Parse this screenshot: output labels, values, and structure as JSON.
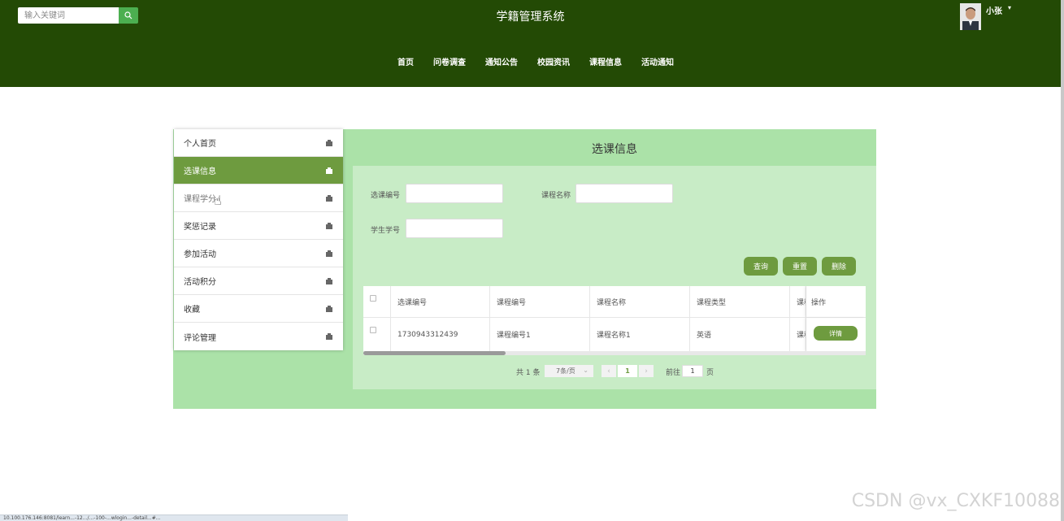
{
  "header": {
    "search": {
      "placeholder": "输入关键词"
    },
    "site_title": "学籍管理系统",
    "user": {
      "name": "小张",
      "caret": "▾"
    },
    "nav": [
      "首页",
      "问卷调查",
      "通知公告",
      "校园资讯",
      "课程信息",
      "活动通知"
    ]
  },
  "sidebar": {
    "items": [
      {
        "label": "个人首页"
      },
      {
        "label": "选课信息"
      },
      {
        "label": "课程学分"
      },
      {
        "label": "奖惩记录"
      },
      {
        "label": "参加活动"
      },
      {
        "label": "活动积分"
      },
      {
        "label": "收藏"
      },
      {
        "label": "评论管理"
      }
    ],
    "active_index": 1
  },
  "main": {
    "title": "选课信息",
    "filters": {
      "course_select_no_label": "选课编号",
      "course_name_label": "课程名称",
      "student_no_label": "学生学号"
    },
    "buttons": {
      "query": "查询",
      "reset": "重置",
      "delete": "删除"
    },
    "table": {
      "headers": [
        "选课编号",
        "课程编号",
        "课程名称",
        "课程类型",
        "课程",
        "操作"
      ],
      "rows": [
        {
          "select_no": "1730943312439",
          "course_no": "课程编号1",
          "course_name": "课程名称1",
          "course_type": "英语",
          "course_extra": "课程",
          "action": "详情"
        }
      ]
    },
    "pagination": {
      "total": "共 1 条",
      "page_size": "7条/页",
      "prev": "‹",
      "current_page": "1",
      "next": "›",
      "goto_label": "前往",
      "goto_value": "1",
      "page_unit": "页"
    }
  },
  "watermark": "CSDN @vx_CXKF10088",
  "status_bar": "10.100.176.146:8081/learn...-12.../...-100-...wlogin...-detail...#..."
}
